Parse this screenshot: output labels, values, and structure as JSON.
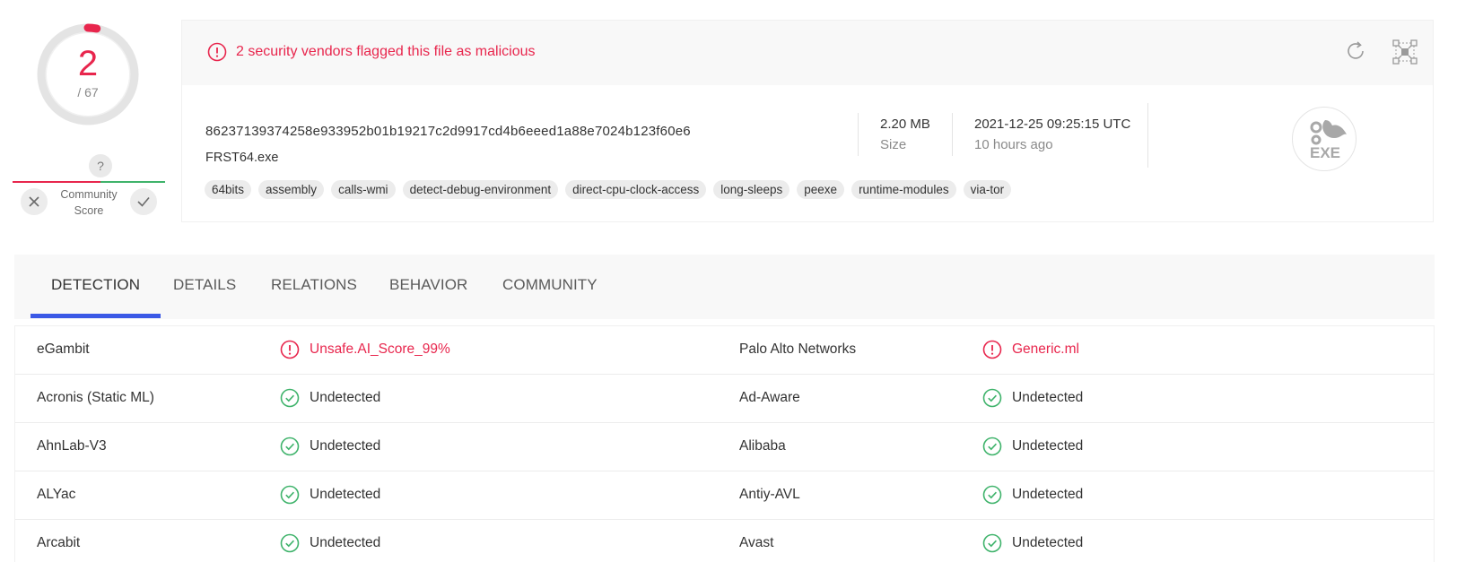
{
  "score": {
    "detections": "2",
    "total": "/ 67",
    "fraction_flagged": 0.0299
  },
  "community": {
    "unknown": "?",
    "label_line1": "Community",
    "label_line2": "Score",
    "down_icon": "close-icon",
    "up_icon": "check-icon"
  },
  "alert": {
    "text": "2 security vendors flagged this file as malicious",
    "color": "#e8264d"
  },
  "file": {
    "hash": "86237139374258e933952b01b19217c2d9917cd4b6eeed1a88e7024b123f60e6",
    "name": "FRST64.exe",
    "size_value": "2.20 MB",
    "size_label": "Size",
    "date": "2021-12-25 09:25:15 UTC",
    "date_ago": "10 hours ago",
    "type_badge": "EXE",
    "tags": [
      "64bits",
      "assembly",
      "calls-wmi",
      "detect-debug-environment",
      "direct-cpu-clock-access",
      "long-sleeps",
      "peexe",
      "runtime-modules",
      "via-tor"
    ]
  },
  "tabs": [
    "DETECTION",
    "DETAILS",
    "RELATIONS",
    "BEHAVIOR",
    "COMMUNITY"
  ],
  "active_tab": "DETECTION",
  "colors": {
    "malicious": "#e8264d",
    "clean": "#3fb36b",
    "accent": "#3b59e6"
  },
  "detections": [
    {
      "left_vendor": "eGambit",
      "left_result": "Unsafe.AI_Score_99%",
      "left_status": "malicious",
      "right_vendor": "Palo Alto Networks",
      "right_result": "Generic.ml",
      "right_status": "malicious"
    },
    {
      "left_vendor": "Acronis (Static ML)",
      "left_result": "Undetected",
      "left_status": "clean",
      "right_vendor": "Ad-Aware",
      "right_result": "Undetected",
      "right_status": "clean"
    },
    {
      "left_vendor": "AhnLab-V3",
      "left_result": "Undetected",
      "left_status": "clean",
      "right_vendor": "Alibaba",
      "right_result": "Undetected",
      "right_status": "clean"
    },
    {
      "left_vendor": "ALYac",
      "left_result": "Undetected",
      "left_status": "clean",
      "right_vendor": "Antiy-AVL",
      "right_result": "Undetected",
      "right_status": "clean"
    },
    {
      "left_vendor": "Arcabit",
      "left_result": "Undetected",
      "left_status": "clean",
      "right_vendor": "Avast",
      "right_result": "Undetected",
      "right_status": "clean"
    }
  ]
}
